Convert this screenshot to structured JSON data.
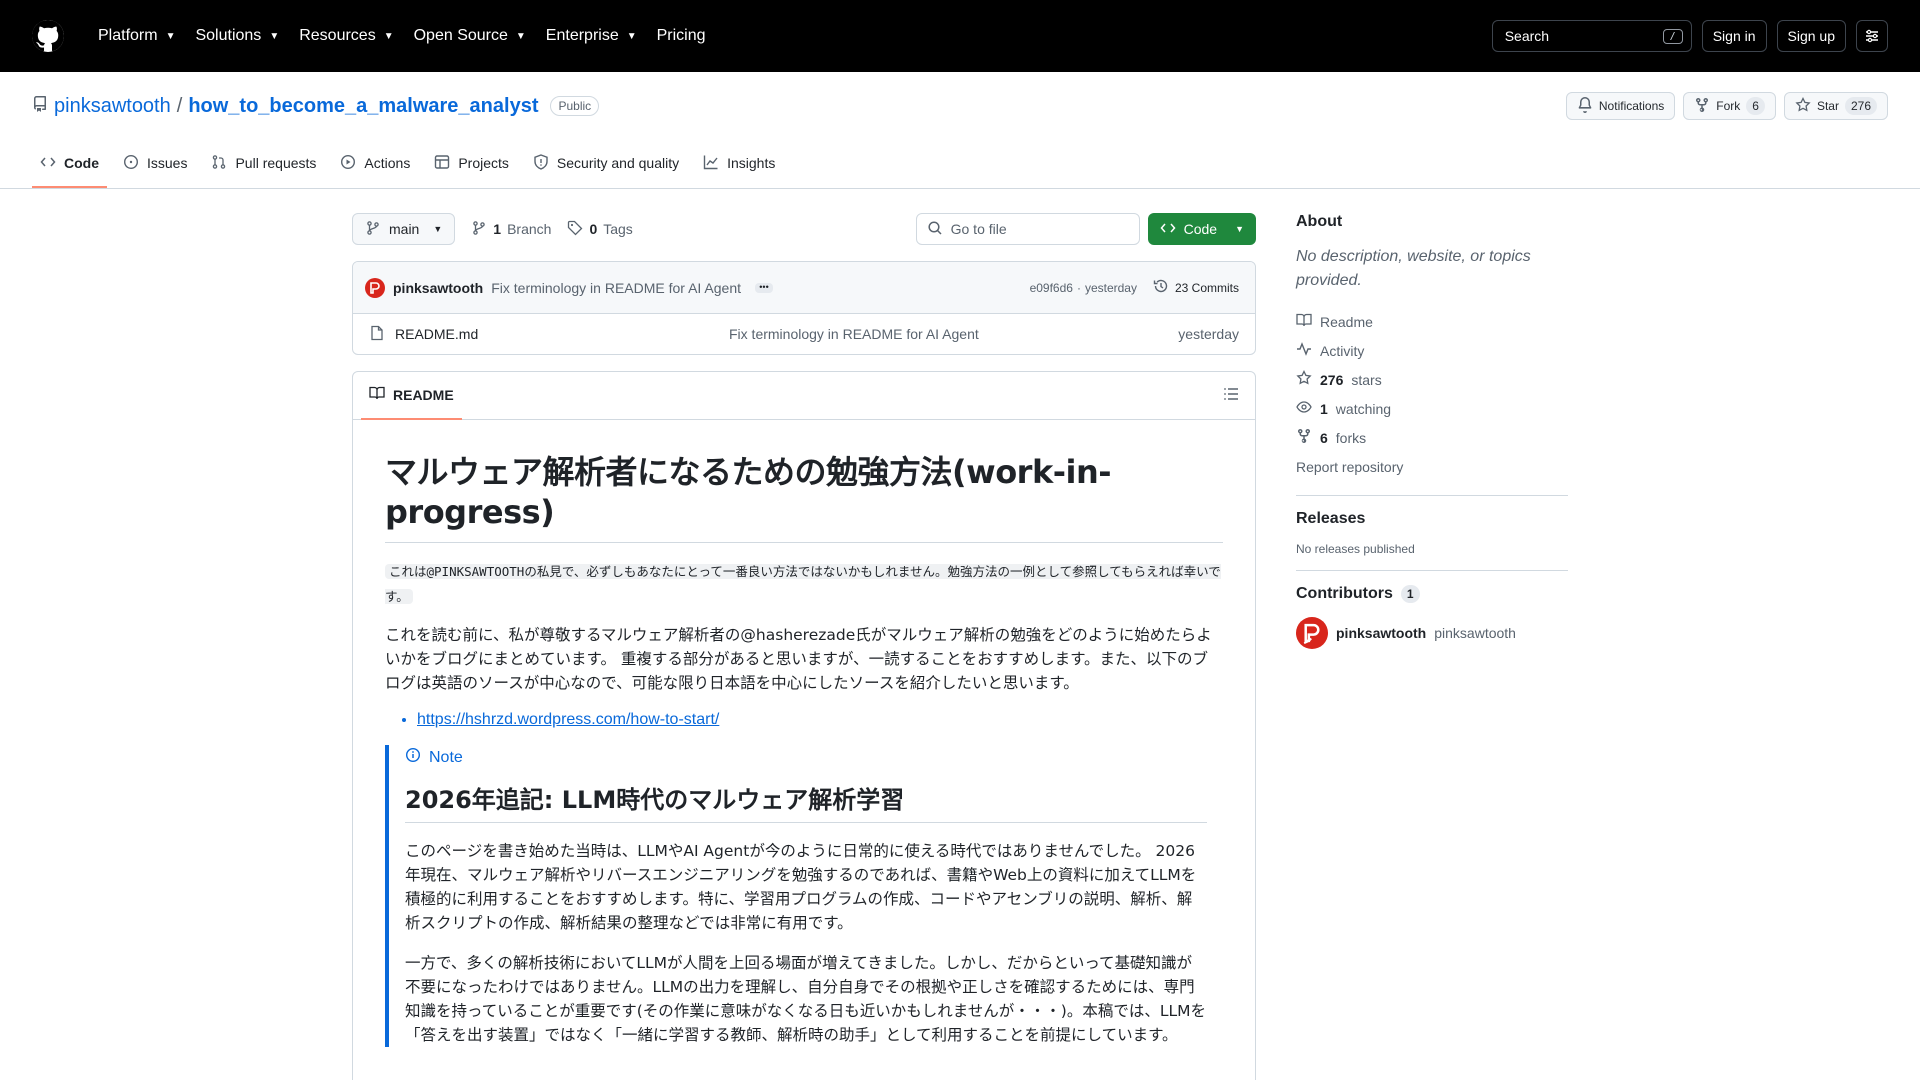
{
  "header": {
    "nav": [
      "Platform",
      "Solutions",
      "Resources",
      "Open Source",
      "Enterprise",
      "Pricing"
    ],
    "search_label": "Search",
    "search_key": "/",
    "sign_in": "Sign in",
    "sign_up": "Sign up"
  },
  "repo": {
    "owner": "pinksawtooth",
    "separator": "/",
    "name": "how_to_become_a_malware_analyst",
    "visibility": "Public",
    "notifications": "Notifications",
    "fork_label": "Fork",
    "fork_count": "6",
    "star_label": "Star",
    "star_count": "276",
    "tabs": [
      "Code",
      "Issues",
      "Pull requests",
      "Actions",
      "Projects",
      "Security and quality",
      "Insights"
    ]
  },
  "files": {
    "branch": "main",
    "branch_count": "1",
    "branch_word": "Branch",
    "tag_count": "0",
    "tag_word": "Tags",
    "go_to_file": "Go to file",
    "code_button": "Code",
    "commit_author": "pinksawtooth",
    "commit_message": "Fix terminology in README for AI Agent",
    "commit_ellipsis": "•••",
    "commit_hash": "e09f6d6",
    "commit_dot": "·",
    "commit_time": "yesterday",
    "commit_count": "23 Commits",
    "rows": [
      {
        "name": "README.md",
        "message": "Fix terminology in README for AI Agent",
        "time": "yesterday"
      }
    ]
  },
  "readme": {
    "tab": "README",
    "h1": "マルウェア解析者になるための勉強方法(work-in-progress)",
    "code_note": "これは@PINKSAWTOOTHの私見で、必ずしもあなたにとって一番良い方法ではないかもしれません。勉強方法の一例として参照してもらえれば幸いです。",
    "p1": "これを読む前に、私が尊敬するマルウェア解析者の@hasherezade氏がマルウェア解析の勉強をどのように始めたらよいかをブログにまとめています。 重複する部分があると思いますが、一読することをおすすめします。また、以下のブログは英語のソースが中心なので、可能な限り日本語を中心にしたソースを紹介したいと思います。",
    "link": "https://hshrzd.wordpress.com/how-to-start/",
    "note_label": "Note",
    "h2": "2026年追記: LLM時代のマルウェア解析学習",
    "p2": "このページを書き始めた当時は、LLMやAI Agentが今のように日常的に使える時代ではありませんでした。 2026年現在、マルウェア解析やリバースエンジニアリングを勉強するのであれば、書籍やWeb上の資料に加えてLLMを積極的に利用することをおすすめします。特に、学習用プログラムの作成、コードやアセンブリの説明、解析、解析スクリプトの作成、解析結果の整理などでは非常に有用です。",
    "p3": "一方で、多くの解析技術においてLLMが人間を上回る場面が増えてきました。しかし、だからといって基礎知識が不要になったわけではありません。LLMの出力を理解し、自分自身でその根拠や正しさを確認するためには、専門知識を持っていることが重要です(その作業に意味がなくなる日も近いかもしれませんが・・・)。本稿では、LLMを「答えを出す装置」ではなく「一緒に学習する教師、解析時の助手」として利用することを前提にしています。"
  },
  "sidebar": {
    "about_title": "About",
    "about_desc": "No description, website, or topics provided.",
    "readme": "Readme",
    "activity": "Activity",
    "stars_count": "276",
    "stars_word": "stars",
    "watching_count": "1",
    "watching_word": "watching",
    "forks_count": "6",
    "forks_word": "forks",
    "report": "Report repository",
    "releases_title": "Releases",
    "releases_none": "No releases published",
    "contributors_title": "Contributors",
    "contributors_count": "1",
    "contributor_name": "pinksawtooth",
    "contributor_login": "pinksawtooth"
  }
}
